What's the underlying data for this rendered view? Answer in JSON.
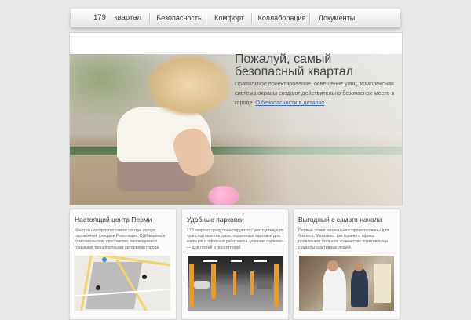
{
  "nav": {
    "brand_number": "179",
    "brand_word": "квартал",
    "items": [
      "Безопасность",
      "Комфорт",
      "Коллаборация",
      "Документы"
    ]
  },
  "hero": {
    "title_line1": "Пожалуй, самый",
    "title_line2": "безопасный квартал",
    "text": "Правильное проектирование, освещение улиц, комплексная система охраны создают действительно безопасное место в городе.",
    "link": "О безопасности в деталях"
  },
  "cards": [
    {
      "title": "Настоящий центр Перми",
      "text": "Квартал находится в самом центре города, окружённый улицами Революции, Куйбышева и Комсомольским проспектом, являющимися главными транспортными артериями города"
    },
    {
      "title": "Удобные парковки",
      "text": "179 квартал сразу проектируется с учетом текущих транспортных нагрузок, подземные парковки для жильцов и офисных работников, уличная парковка — для гостей и посетителей."
    },
    {
      "title": "Выгодный с самого начала",
      "text": "Первые этажи изначально спроектированы для бизнеса. Магазины, рестораны и офисы привлекают большое количество позитивных и социально активных людей."
    }
  ],
  "colors": {
    "page_bg": "#e9e9e9",
    "link": "#3a6fb0",
    "map_road": "#f3d36a",
    "parking_pillar": "#e99a2a"
  }
}
